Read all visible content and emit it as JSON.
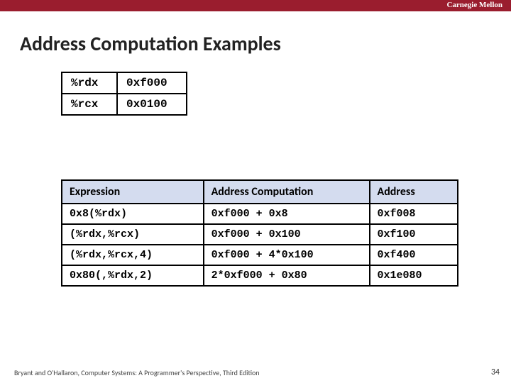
{
  "header": {
    "org": "Carnegie Mellon"
  },
  "title": "Address Computation Examples",
  "registers": [
    {
      "name": "%rdx",
      "value": "0xf000"
    },
    {
      "name": "%rcx",
      "value": "0x0100"
    }
  ],
  "expr_table": {
    "headers": [
      "Expression",
      "Address Computation",
      "Address"
    ],
    "rows": [
      {
        "expr": "0x8(%rdx)",
        "comp": "0xf000 + 0x8",
        "addr": "0xf008"
      },
      {
        "expr": "(%rdx,%rcx)",
        "comp": "0xf000 + 0x100",
        "addr": "0xf100"
      },
      {
        "expr": "(%rdx,%rcx,4)",
        "comp": "0xf000 + 4*0x100",
        "addr": "0xf400"
      },
      {
        "expr": "0x80(,%rdx,2)",
        "comp": "2*0xf000 + 0x80",
        "addr": "0x1e080"
      }
    ]
  },
  "footer": "Bryant and O'Hallaron, Computer Systems: A Programmer's Perspective, Third Edition",
  "page": "34"
}
